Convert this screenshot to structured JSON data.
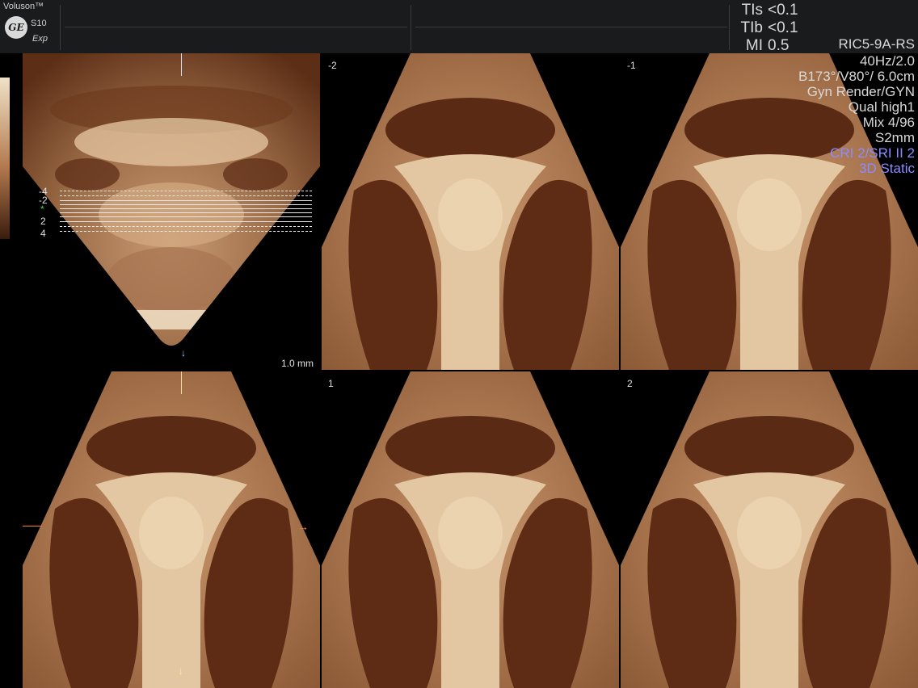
{
  "brand": {
    "name": "Voluson™",
    "model": "S10",
    "tier": "Exp",
    "logo": "GE"
  },
  "safety": [
    {
      "label": "TIs",
      "value": "<0.1"
    },
    {
      "label": "TIb",
      "value": "<0.1"
    },
    {
      "label": "MI",
      "value": "0.5"
    }
  ],
  "probe": "RIC5-9A-RS",
  "settings": [
    {
      "text": "40Hz/2.0",
      "color": "white"
    },
    {
      "text": "B173°/V80°/ 6.0cm",
      "color": "white"
    },
    {
      "text": "Gyn Render/GYN",
      "color": "white"
    },
    {
      "text": "Qual high1",
      "color": "white"
    },
    {
      "text": "Mix 4/96",
      "color": "white"
    },
    {
      "text": "S2mm",
      "color": "white"
    },
    {
      "text": "CRI 2/SRI II 2",
      "color": "blue"
    },
    {
      "text": "3D Static",
      "color": "blue"
    }
  ],
  "slice_spacing": "1.0 mm",
  "slice_marks": [
    "-4",
    "-2",
    "*",
    "2",
    "4"
  ],
  "panels": [
    {
      "id": "reference",
      "label": ""
    },
    {
      "id": "slice-minus-2",
      "label": "-2"
    },
    {
      "id": "slice-minus-1",
      "label": "-1"
    },
    {
      "id": "slice-center",
      "label": ""
    },
    {
      "id": "slice-1",
      "label": "1"
    },
    {
      "id": "slice-2",
      "label": "2"
    }
  ],
  "colors": {
    "tissue_light": "#e9cfa8",
    "tissue_mid": "#b9825a",
    "tissue_dark": "#5a2a14",
    "accent_blue": "#8a8cff",
    "marker_orange": "#ff7a2a"
  }
}
